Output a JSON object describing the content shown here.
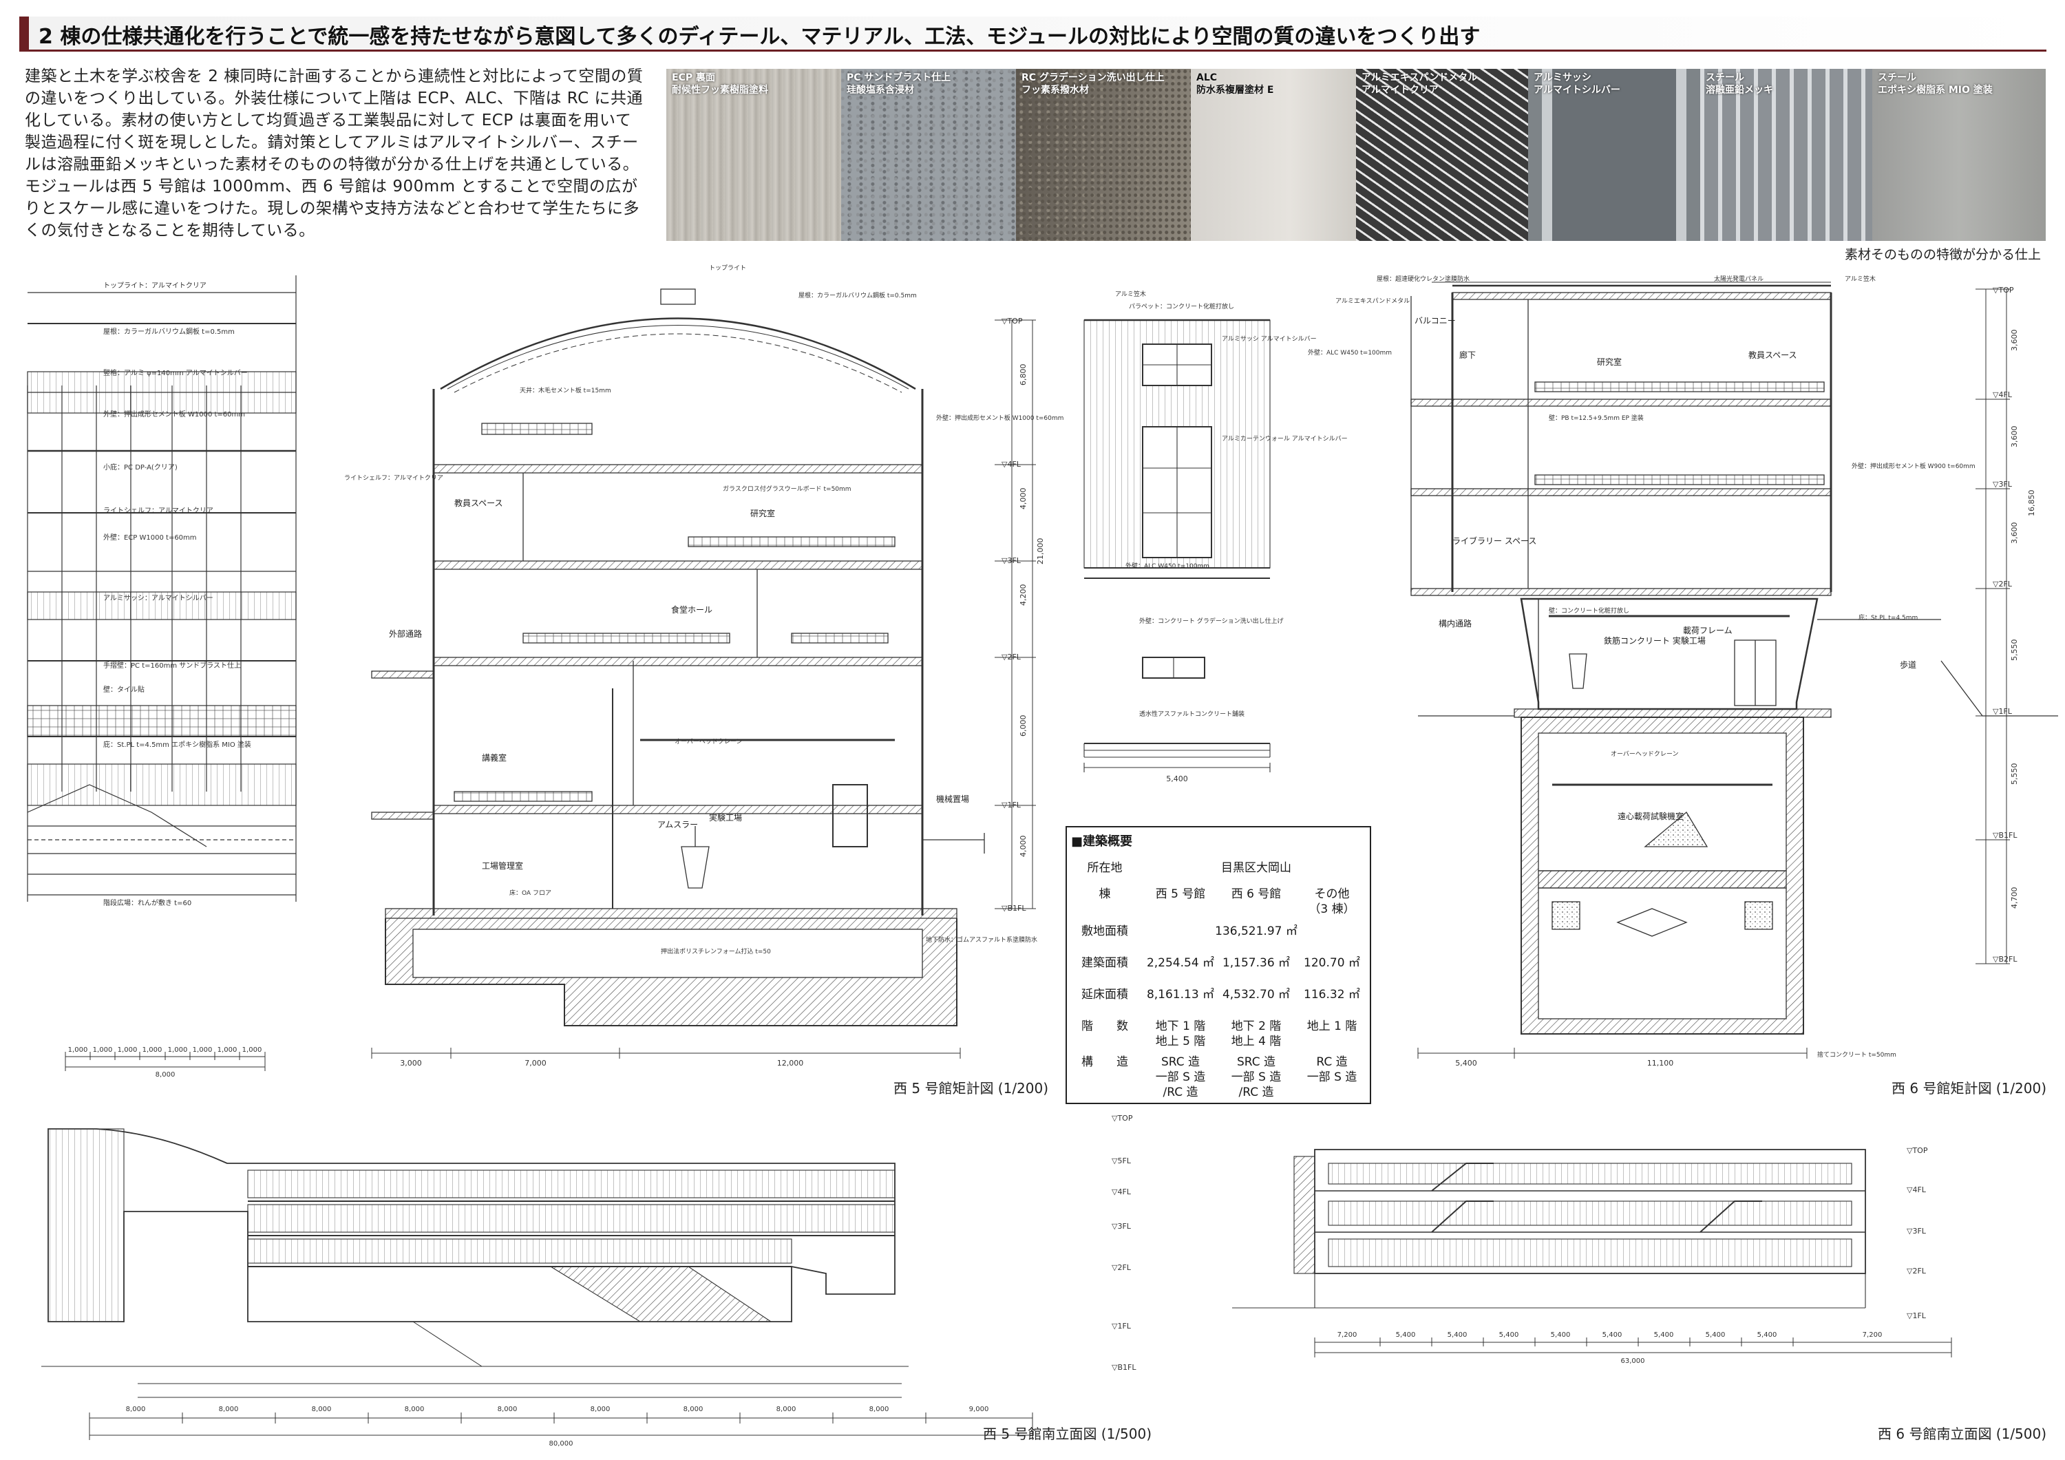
{
  "title": "2 棟の仕様共通化を行うことで統一感を持たせながら意図して多くのディテール、マテリアル、工法、モジュールの対比により空間の質の違いをつくり出す",
  "intro": "建築と土木を学ぶ校舎を 2 棟同時に計画することから連続性と対比によって空間の質の違いをつくり出している。外装仕様について上階は ECP、ALC、下階は RC に共通化している。素材の使い方として均質過ぎる工業製品に対して ECP は裏面を用いて製造過程に付く斑を現しとした。錆対策としてアルミはアルマイトシルバー、スチールは溶融亜鉛メッキといった素材そのものの特徴が分かる仕上げを共通としている。モジュールは西 5 号館は 1000mm、西 6 号館は 900mm とすることで空間の広がりとスケール感に違いをつけた。現しの架構や支持方法などと合わせて学生たちに多くの気付きとなることを期待している。",
  "materials": [
    {
      "line1": "ECP 裏面",
      "line2": "耐候性フッ素樹脂塗料"
    },
    {
      "line1": "PC サンドブラスト仕上",
      "line2": "珪酸塩系含浸材"
    },
    {
      "line1": "RC グラデーション洗い出し仕上",
      "line2": "フッ素系撥水材"
    },
    {
      "line1": "ALC",
      "line2": "防水系複層塗材 E"
    },
    {
      "line1": "アルミエキスパンドメタル",
      "line2": "アルマイトクリア"
    },
    {
      "line1": "アルミサッシ",
      "line2": "アルマイトシルバー"
    },
    {
      "line1": "スチール",
      "line2": "溶融亜鉛メッキ"
    },
    {
      "line1": "スチール",
      "line2": "エポキシ樹脂系 MIO 塗装"
    }
  ],
  "materials_caption": "素材そのものの特徴が分かる仕上",
  "captions": {
    "w5_section": "西 5 号館矩計図 (1/200)",
    "w6_section": "西 6 号館矩計図 (1/200)",
    "w5_elev": "西 5 号館南立面図 (1/500)",
    "w6_elev": "西 6 号館南立面図 (1/500)"
  },
  "overview": {
    "title": "■建築概要",
    "site_label": "所在地",
    "site_value": "目黒区大岡山",
    "bldg_label": "棟",
    "cols": [
      "西 5 号館",
      "西 6 号館",
      "その他\n（3 棟）"
    ],
    "rows": [
      {
        "label": "敷地面積",
        "values": [
          "136,521.97 ㎡"
        ]
      },
      {
        "label": "建築面積",
        "values": [
          "2,254.54 ㎡",
          "1,157.36 ㎡",
          "120.70 ㎡"
        ]
      },
      {
        "label": "延床面積",
        "values": [
          "8,161.13 ㎡",
          "4,532.70 ㎡",
          "116.32 ㎡"
        ]
      },
      {
        "label": "階　　数",
        "values": [
          "地下 1 階\n地上 5 階",
          "地下 2 階\n地上 4 階",
          "地上 1 階"
        ]
      },
      {
        "label": "構　　造",
        "values": [
          "SRC 造\n一部 S 造\n/RC 造",
          "SRC 造\n一部 S 造\n/RC 造",
          "RC 造\n一部 S 造"
        ]
      }
    ]
  },
  "dims": {
    "wall_bays": [
      "1,000",
      "1,000",
      "1,000",
      "1,000",
      "1,000",
      "1,000",
      "1,000",
      "1,000"
    ],
    "wall_total": "8,000",
    "w5_sec": [
      "3,000",
      "7,000",
      "12,000"
    ],
    "alc_width": "5,400",
    "w6_sec": [
      "5,400",
      "11,100"
    ],
    "w5_elev": [
      "8,000",
      "8,000",
      "8,000",
      "8,000",
      "8,000",
      "8,000",
      "8,000",
      "8,000",
      "8,000",
      "9,000"
    ],
    "w5_elev_total": "80,000",
    "w6_elev": [
      "7,200",
      "5,400",
      "5,400",
      "5,400",
      "5,400",
      "5,400",
      "5,400",
      "5,400",
      "5,400",
      "7,200"
    ],
    "w6_elev_total": "63,000"
  },
  "levels": {
    "w5": [
      "▽TOP",
      "▽4FL",
      "▽3FL",
      "▽2FL",
      "▽1FL",
      "▽B1FL"
    ],
    "w5_heights": [
      "6,800",
      "4,000",
      "4,200",
      "6,000",
      "4,000"
    ],
    "w5_total": "21,000",
    "w6": [
      "▽TOP",
      "▽4FL",
      "▽3FL",
      "▽2FL",
      "▽1FL",
      "▽B1FL",
      "▽B2FL"
    ],
    "w6_heights": [
      "3,600",
      "3,600",
      "3,600",
      "5,550",
      "5,550",
      "4,700"
    ],
    "w6_total": "16,850",
    "w5_elev_levels": [
      "▽TOP",
      "▽5FL",
      "▽4FL",
      "▽3FL",
      "▽2FL",
      "▽1FL",
      "▽B1FL"
    ],
    "w6_elev_levels": [
      "▽TOP",
      "▽4FL",
      "▽3FL",
      "▽2FL",
      "▽1FL"
    ]
  },
  "rooms": {
    "w5": [
      "教員スペース",
      "研究室",
      "食堂ホール",
      "講義室",
      "工場管理室",
      "実験工場",
      "アムスラー",
      "外部通路",
      "機械置場"
    ],
    "w6": [
      "研究室",
      "教員スペース",
      "ライブラリー スペース",
      "鉄筋コンクリート 実験工場",
      "載荷フレーム",
      "遠心載荷試験機室",
      "廊下",
      "バルコニー",
      "構内通路",
      "歩道"
    ]
  },
  "notes": {
    "wall": [
      "トップライト：アルマイトクリア",
      "屋根：カラーガルバリウム鋼板 t=0.5mm",
      "竪格：アルミ φ=140mm アルマイトシルバー",
      "外壁：押出成形セメント板 W1000 t=60mm",
      "小庇：PC DP-A(クリア)",
      "ライトシェルフ：アルマイトクリア",
      "外壁：ECP W1000 t=60mm",
      "アルミサッシ：アルマイトシルバー",
      "手摺壁：PC t=160mm サンドブラスト仕上",
      "壁：タイル貼",
      "庇：St.PL t=4.5mm エポキシ樹脂系 MIO 塗装",
      "階段広場：れんが敷き t=60"
    ],
    "w5": [
      "トップライト",
      "天井：木毛セメント板 t=15mm",
      "屋根：カラーガルバリウム鋼板 t=0.5mm",
      "外壁：押出成形セメント板 W1000 t=60mm",
      "ライトシェルフ：アルマイトクリア",
      "ガラスクロス付グラスウールボード t=50mm",
      "オーバーヘッドクレーン",
      "床：OA フロア",
      "地下防水：ゴムアスファルト系塗膜防水",
      "押出法ポリスチレンフォーム打込 t=50"
    ],
    "w6": [
      "屋根：超速硬化ウレタン塗膜防水",
      "太陽光発電パネル",
      "アルミ笠木",
      "アルミエキスパンドメタル",
      "外壁：ALC W450 t=100mm",
      "壁：PB t=12.5+9.5mm EP 塗装",
      "壁：コンクリート化粧打放し",
      "オーバーヘッドクレーン",
      "外壁：押出成形セメント板 W900 t=60mm",
      "庇：St.PL t=4.5mm",
      "捨てコンクリート t=50mm"
    ],
    "alc": [
      "アルミ笠木",
      "パラペット：コンクリート化粧打放し",
      "アルミサッシ アルマイトシルバー",
      "アルミカーテンウォール アルマイトシルバー",
      "外壁：ALC W450 t=100mm",
      "外壁：コンクリート グラデーション洗い出し仕上げ",
      "透水性アスファルトコンクリート舗装"
    ]
  },
  "colors": {
    "accent": "#6b1f23",
    "line": "#333333",
    "hatch": "#555555"
  }
}
